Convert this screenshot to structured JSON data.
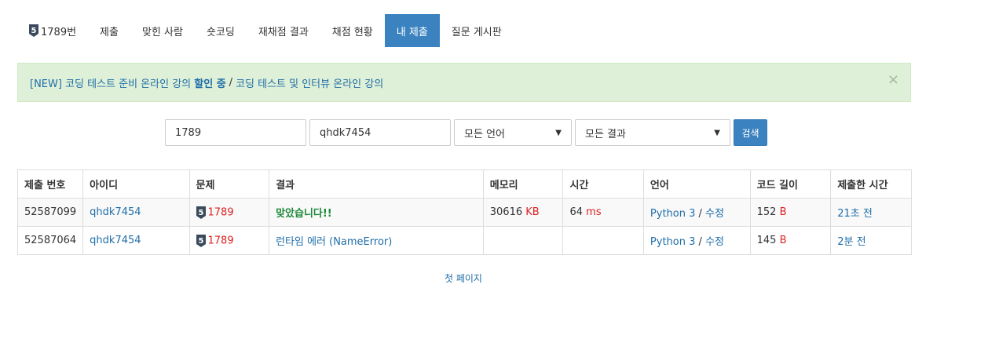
{
  "tabs": [
    {
      "label": "1789번",
      "active": false,
      "has_badge": true
    },
    {
      "label": "제출",
      "active": false
    },
    {
      "label": "맞힌 사람",
      "active": false
    },
    {
      "label": "숏코딩",
      "active": false
    },
    {
      "label": "재채점 결과",
      "active": false
    },
    {
      "label": "채점 현황",
      "active": false
    },
    {
      "label": "내 제출",
      "active": true
    },
    {
      "label": "질문 게시판",
      "active": false
    }
  ],
  "badge": {
    "number": "5",
    "color": "#3a4a5c"
  },
  "alert": {
    "part1": "[NEW] 코딩 테스트 준비 온라인 강의 ",
    "part1_strong": "할인 중",
    "separator": "/",
    "part2": "코딩 테스트 및 인터뷰 온라인 강의",
    "close": "×"
  },
  "search": {
    "problem_id": "1789",
    "user_id": "qhdk7454",
    "language_selected": "모든 언어",
    "result_selected": "모든 결과",
    "button": "검색"
  },
  "table": {
    "headers": [
      "제출 번호",
      "아이디",
      "문제",
      "결과",
      "메모리",
      "시간",
      "언어",
      "코드 길이",
      "제출한 시간"
    ],
    "rows": [
      {
        "submission_id": "52587099",
        "user": "qhdk7454",
        "problem": "1789",
        "result": "맞았습니다!!",
        "memory": "30616",
        "memory_unit": "KB",
        "time": "64",
        "time_unit": "ms",
        "language": "Python 3",
        "lang_sep": "/",
        "edit": "수정",
        "code_length": "152",
        "code_unit": "B",
        "submitted": "21초 전"
      },
      {
        "submission_id": "52587064",
        "user": "qhdk7454",
        "problem": "1789",
        "result": "런타임 에러 (NameError)",
        "memory": "",
        "memory_unit": "",
        "time": "",
        "time_unit": "",
        "language": "Python 3",
        "lang_sep": "/",
        "edit": "수정",
        "code_length": "145",
        "code_unit": "B",
        "submitted": "2분 전"
      }
    ]
  },
  "pager": {
    "first_page": "첫 페이지"
  }
}
